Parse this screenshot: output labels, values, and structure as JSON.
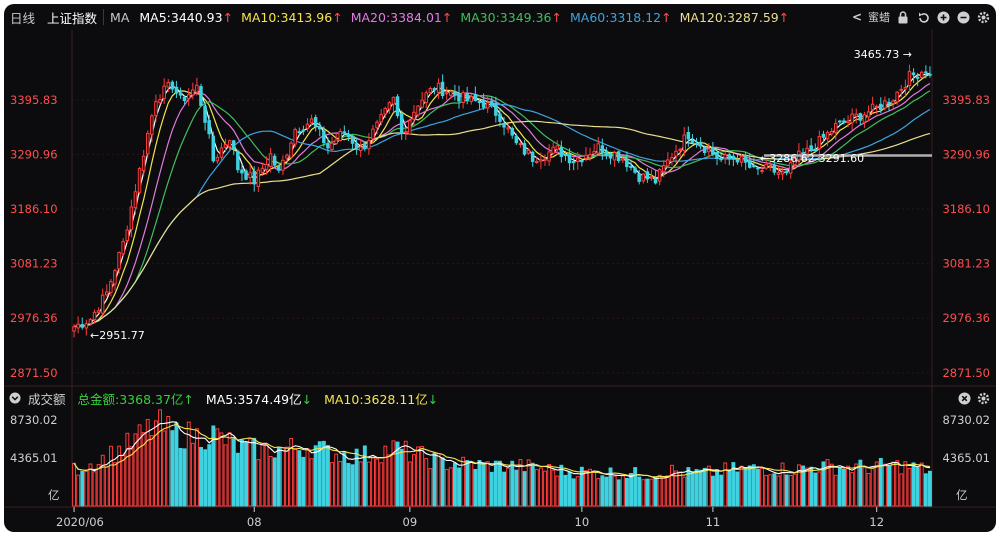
{
  "toolbar": {
    "period": "日线",
    "index_name": "上证指数",
    "ma_label": "MA",
    "ma": [
      {
        "label": "MA5:3440.93",
        "color": "#ffffff",
        "arrow": "↑"
      },
      {
        "label": "MA10:3413.96",
        "color": "#f3e54c",
        "arrow": "↑"
      },
      {
        "label": "MA20:3384.01",
        "color": "#e27be0",
        "arrow": "↑"
      },
      {
        "label": "MA30:3349.36",
        "color": "#3fbf5c",
        "arrow": "↑"
      },
      {
        "label": "MA60:3318.12",
        "color": "#3da4e0",
        "arrow": "↑"
      },
      {
        "label": "MA120:3287.59",
        "color": "#e9de8e",
        "arrow": "↑"
      }
    ],
    "collapse_glyph": "<",
    "settings_label": "蜜蜡"
  },
  "price_axis": {
    "ticks": [
      "3395.83",
      "3290.96",
      "3186.10",
      "3081.23",
      "2976.36",
      "2871.50"
    ],
    "tick_values": [
      3395.83,
      3290.96,
      3186.1,
      3081.23,
      2976.36,
      2871.5
    ],
    "ylim": [
      2850,
      3530
    ]
  },
  "annotations": {
    "high": "3465.73",
    "low": "2951.77",
    "range": "3286.62-3291.60"
  },
  "volume": {
    "title": "成交额",
    "total_label": "总金额:3368.37亿",
    "ma5_label": "MA5:3574.49亿",
    "ma10_label": "MA10:3628.11亿",
    "ticks": [
      "8730.02",
      "4365.01",
      "亿"
    ],
    "ylim": [
      0,
      9400
    ]
  },
  "x_axis": {
    "labels": [
      "2020/06",
      "08",
      "09",
      "10",
      "11",
      "12"
    ],
    "label_index": [
      0,
      44,
      82,
      124,
      156,
      196
    ]
  },
  "colors": {
    "up": "#ff3a3a",
    "down": "#3fd2e0",
    "background": "#0c0c0e",
    "grid": "#2b1414",
    "text": "#c9c9c9"
  },
  "chart_data": {
    "type": "candlestick",
    "n_candles": 210,
    "price_keypoints": [
      [
        0,
        2960
      ],
      [
        4,
        2975
      ],
      [
        8,
        3025
      ],
      [
        12,
        3120
      ],
      [
        16,
        3260
      ],
      [
        20,
        3400
      ],
      [
        24,
        3425
      ],
      [
        26,
        3395
      ],
      [
        30,
        3420
      ],
      [
        32,
        3360
      ],
      [
        34,
        3280
      ],
      [
        38,
        3325
      ],
      [
        40,
        3265
      ],
      [
        44,
        3240
      ],
      [
        48,
        3290
      ],
      [
        50,
        3255
      ],
      [
        54,
        3340
      ],
      [
        58,
        3355
      ],
      [
        62,
        3305
      ],
      [
        66,
        3335
      ],
      [
        70,
        3300
      ],
      [
        74,
        3345
      ],
      [
        78,
        3395
      ],
      [
        80,
        3330
      ],
      [
        84,
        3390
      ],
      [
        88,
        3420
      ],
      [
        92,
        3410
      ],
      [
        96,
        3395
      ],
      [
        100,
        3390
      ],
      [
        104,
        3365
      ],
      [
        108,
        3310
      ],
      [
        112,
        3285
      ],
      [
        118,
        3300
      ],
      [
        122,
        3280
      ],
      [
        128,
        3305
      ],
      [
        134,
        3285
      ],
      [
        138,
        3250
      ],
      [
        142,
        3240
      ],
      [
        146,
        3290
      ],
      [
        150,
        3330
      ],
      [
        154,
        3305
      ],
      [
        158,
        3280
      ],
      [
        162,
        3285
      ],
      [
        166,
        3260
      ],
      [
        170,
        3262
      ],
      [
        174,
        3250
      ],
      [
        176,
        3282
      ],
      [
        180,
        3300
      ],
      [
        186,
        3345
      ],
      [
        190,
        3360
      ],
      [
        196,
        3380
      ],
      [
        200,
        3400
      ],
      [
        204,
        3440
      ],
      [
        208,
        3455
      ],
      [
        209,
        3440
      ]
    ],
    "volume_keypoints": [
      [
        0,
        3600
      ],
      [
        6,
        4400
      ],
      [
        14,
        6200
      ],
      [
        20,
        8100
      ],
      [
        24,
        7200
      ],
      [
        30,
        6900
      ],
      [
        34,
        7100
      ],
      [
        40,
        5800
      ],
      [
        46,
        5500
      ],
      [
        52,
        5700
      ],
      [
        58,
        5900
      ],
      [
        62,
        5300
      ],
      [
        70,
        4900
      ],
      [
        78,
        5700
      ],
      [
        84,
        5000
      ],
      [
        90,
        4300
      ],
      [
        100,
        4000
      ],
      [
        110,
        3900
      ],
      [
        120,
        3400
      ],
      [
        130,
        3300
      ],
      [
        140,
        3100
      ],
      [
        146,
        3500
      ],
      [
        150,
        3200
      ],
      [
        156,
        3300
      ],
      [
        160,
        3600
      ],
      [
        170,
        3700
      ],
      [
        176,
        3600
      ],
      [
        182,
        3900
      ],
      [
        190,
        3800
      ],
      [
        196,
        3900
      ],
      [
        202,
        4000
      ],
      [
        209,
        3500
      ]
    ],
    "ma_series": [
      {
        "name": "MA5",
        "color": "#ffffff",
        "smooth": 2
      },
      {
        "name": "MA10",
        "color": "#f3e54c",
        "smooth": 5
      },
      {
        "name": "MA20",
        "color": "#e27be0",
        "smooth": 10
      },
      {
        "name": "MA30",
        "color": "#3fbf5c",
        "smooth": 15
      },
      {
        "name": "MA60",
        "color": "#3da4e0",
        "smooth": 30
      },
      {
        "name": "MA120",
        "color": "#e9de8e",
        "smooth": 60
      }
    ]
  }
}
